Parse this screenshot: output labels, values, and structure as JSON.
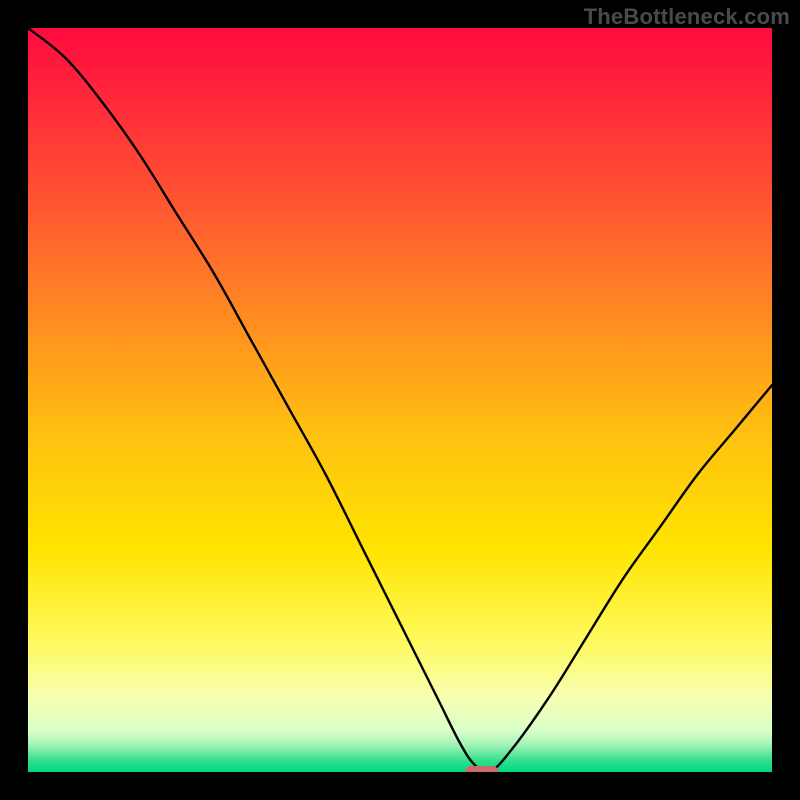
{
  "watermark": "TheBottleneck.com",
  "chart_data": {
    "type": "line",
    "title": "",
    "xlabel": "",
    "ylabel": "",
    "x_range": [
      0,
      100
    ],
    "y_range": [
      0,
      100
    ],
    "curve": {
      "name": "bottleneck-curve",
      "x": [
        0,
        5,
        10,
        15,
        20,
        25,
        30,
        35,
        40,
        45,
        50,
        55,
        58,
        60,
        62,
        65,
        70,
        75,
        80,
        85,
        90,
        95,
        100
      ],
      "y": [
        100,
        96,
        90,
        83,
        75,
        67,
        58,
        49,
        40,
        30,
        20,
        10,
        4,
        1,
        0,
        3,
        10,
        18,
        26,
        33,
        40,
        46,
        52
      ]
    },
    "marker": {
      "name": "optimum-marker",
      "x": 61,
      "y": 0,
      "width_pct": 4.5,
      "height_pct": 1.6,
      "color": "#cf6a6a"
    },
    "gradient_stops": [
      {
        "offset": 0.0,
        "color": "#ff0a3f"
      },
      {
        "offset": 0.1,
        "color": "#ff2a3a"
      },
      {
        "offset": 0.25,
        "color": "#ff5a30"
      },
      {
        "offset": 0.4,
        "color": "#ff8f20"
      },
      {
        "offset": 0.55,
        "color": "#ffc210"
      },
      {
        "offset": 0.7,
        "color": "#ffe400"
      },
      {
        "offset": 0.82,
        "color": "#fff95a"
      },
      {
        "offset": 0.9,
        "color": "#f6ffb0"
      },
      {
        "offset": 0.945,
        "color": "#d8ffc8"
      },
      {
        "offset": 0.965,
        "color": "#9cf2b4"
      },
      {
        "offset": 0.985,
        "color": "#30e08c"
      },
      {
        "offset": 1.0,
        "color": "#00d780"
      }
    ]
  }
}
